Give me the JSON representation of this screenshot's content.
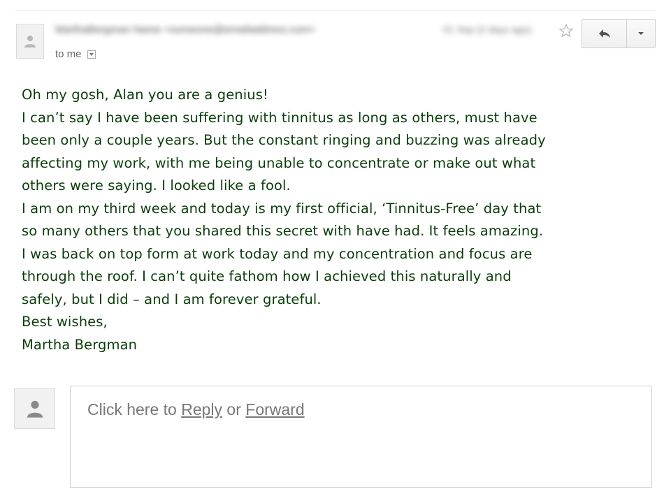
{
  "header": {
    "sender_placeholder": "MarthaBergman Name  <someone@emailaddress.com>",
    "date_placeholder": "01 Sep (2 days ago)",
    "to_me": "to me"
  },
  "icons": {
    "avatar": "person-icon",
    "star": "star-icon",
    "reply": "reply-arrow-icon",
    "more": "caret-down-icon"
  },
  "message": {
    "lines": [
      "Oh my gosh, Alan you are a genius!",
      "I can’t say I have been suffering with tinnitus as long as others, must have",
      "been only a couple years. But the constant ringing and buzzing was already",
      "affecting my work, with me being unable to concentrate or make out what",
      "others were saying. I looked like a fool.",
      "I am on my third week and today is my first official, ‘Tinnitus-Free’ day that",
      "so many others that you shared this secret with have had. It feels amazing.",
      "I was back on top form at work today and my concentration and focus are",
      "through the roof. I can’t quite fathom how I achieved this naturally and",
      "safely, but I did – and I am forever grateful.",
      "Best wishes,",
      "Martha Bergman"
    ]
  },
  "reply_box": {
    "prefix": "Click here to ",
    "reply_label": "Reply",
    "middle": " or ",
    "forward_label": "Forward"
  },
  "colors": {
    "message_text": "#0b3d0b",
    "muted_text": "#777777"
  }
}
